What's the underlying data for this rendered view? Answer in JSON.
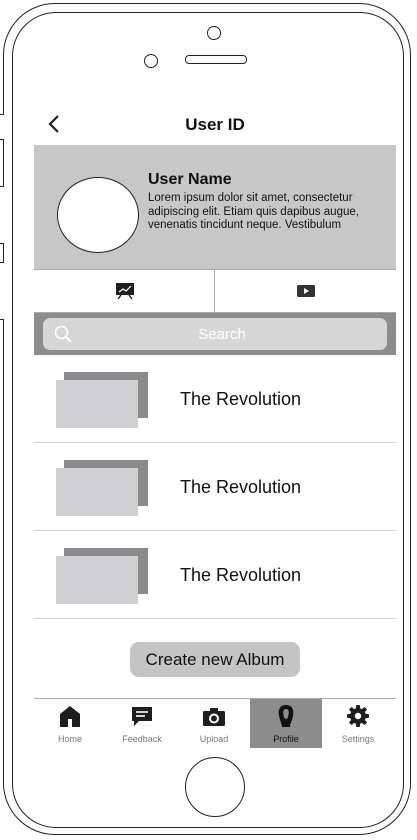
{
  "header": {
    "title": "User ID"
  },
  "profile": {
    "name": "User Name",
    "bio": "Lorem ipsum dolor sit amet, consectetur adipiscing elit. Etiam quis dapibus augue, venenatis tincidunt neque. Vestibulum"
  },
  "tabs": [
    {
      "icon": "presentation-icon"
    },
    {
      "icon": "play-video-icon"
    }
  ],
  "search": {
    "placeholder": "Search"
  },
  "albums": [
    {
      "title": "The Revolution"
    },
    {
      "title": "The Revolution"
    },
    {
      "title": "The Revolution"
    }
  ],
  "create_album_label": "Create new Album",
  "tabbar": {
    "items": [
      {
        "label": "Home",
        "icon": "home-icon"
      },
      {
        "label": "Feedback",
        "icon": "feedback-icon"
      },
      {
        "label": "Upload",
        "icon": "camera-icon"
      },
      {
        "label": "Profile",
        "icon": "profile-icon",
        "active": true
      },
      {
        "label": "Settings",
        "icon": "gear-icon"
      }
    ]
  },
  "colors": {
    "profile_bg": "#c7c7c7",
    "search_strip": "#8c8c8c",
    "active_tab": "#8c8c8c",
    "button_bg": "#c4c4c4"
  }
}
